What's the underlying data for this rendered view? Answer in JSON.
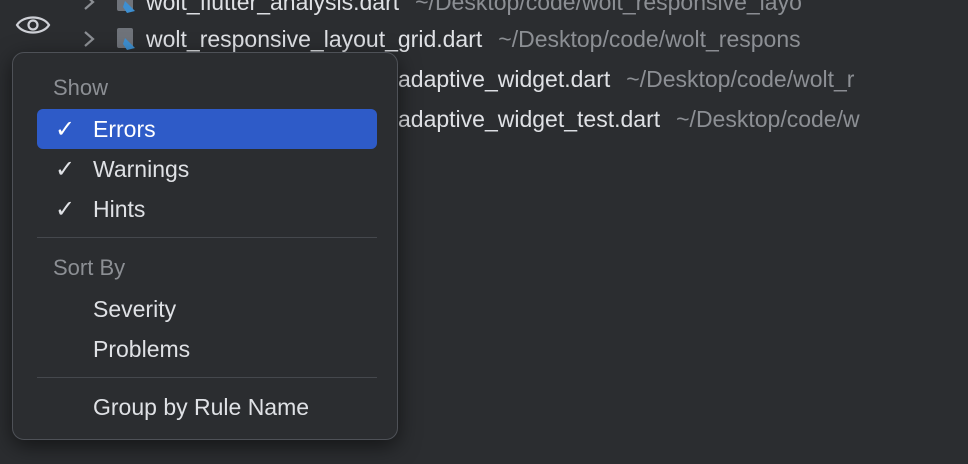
{
  "tree": {
    "rows": [
      {
        "name": "wolt_flutter_analysis.dart",
        "path": "~/Desktop/code/wolt_responsive_layo"
      },
      {
        "name": "wolt_responsive_layout_grid.dart",
        "path": "~/Desktop/code/wolt_respons"
      },
      {
        "name": "adaptive_widget.dart",
        "path": "~/Desktop/code/wolt_r"
      },
      {
        "name": "adaptive_widget_test.dart",
        "path": "~/Desktop/code/w"
      }
    ]
  },
  "menu": {
    "show_header": "Show",
    "show_items": [
      {
        "label": "Errors",
        "checked": "✓"
      },
      {
        "label": "Warnings",
        "checked": "✓"
      },
      {
        "label": "Hints",
        "checked": "✓"
      }
    ],
    "sort_header": "Sort By",
    "sort_items": [
      {
        "label": "Severity"
      },
      {
        "label": "Problems"
      }
    ],
    "group_item": {
      "label": "Group by Rule Name"
    }
  },
  "colors": {
    "background": "#2b2d30",
    "selection": "#2e5bc8",
    "text": "#dfe1e5",
    "muted": "#8c8f94"
  },
  "icons": {
    "toolbar": "eye-icon",
    "expander": "chevron-right-icon",
    "file": "dart-file-icon"
  }
}
